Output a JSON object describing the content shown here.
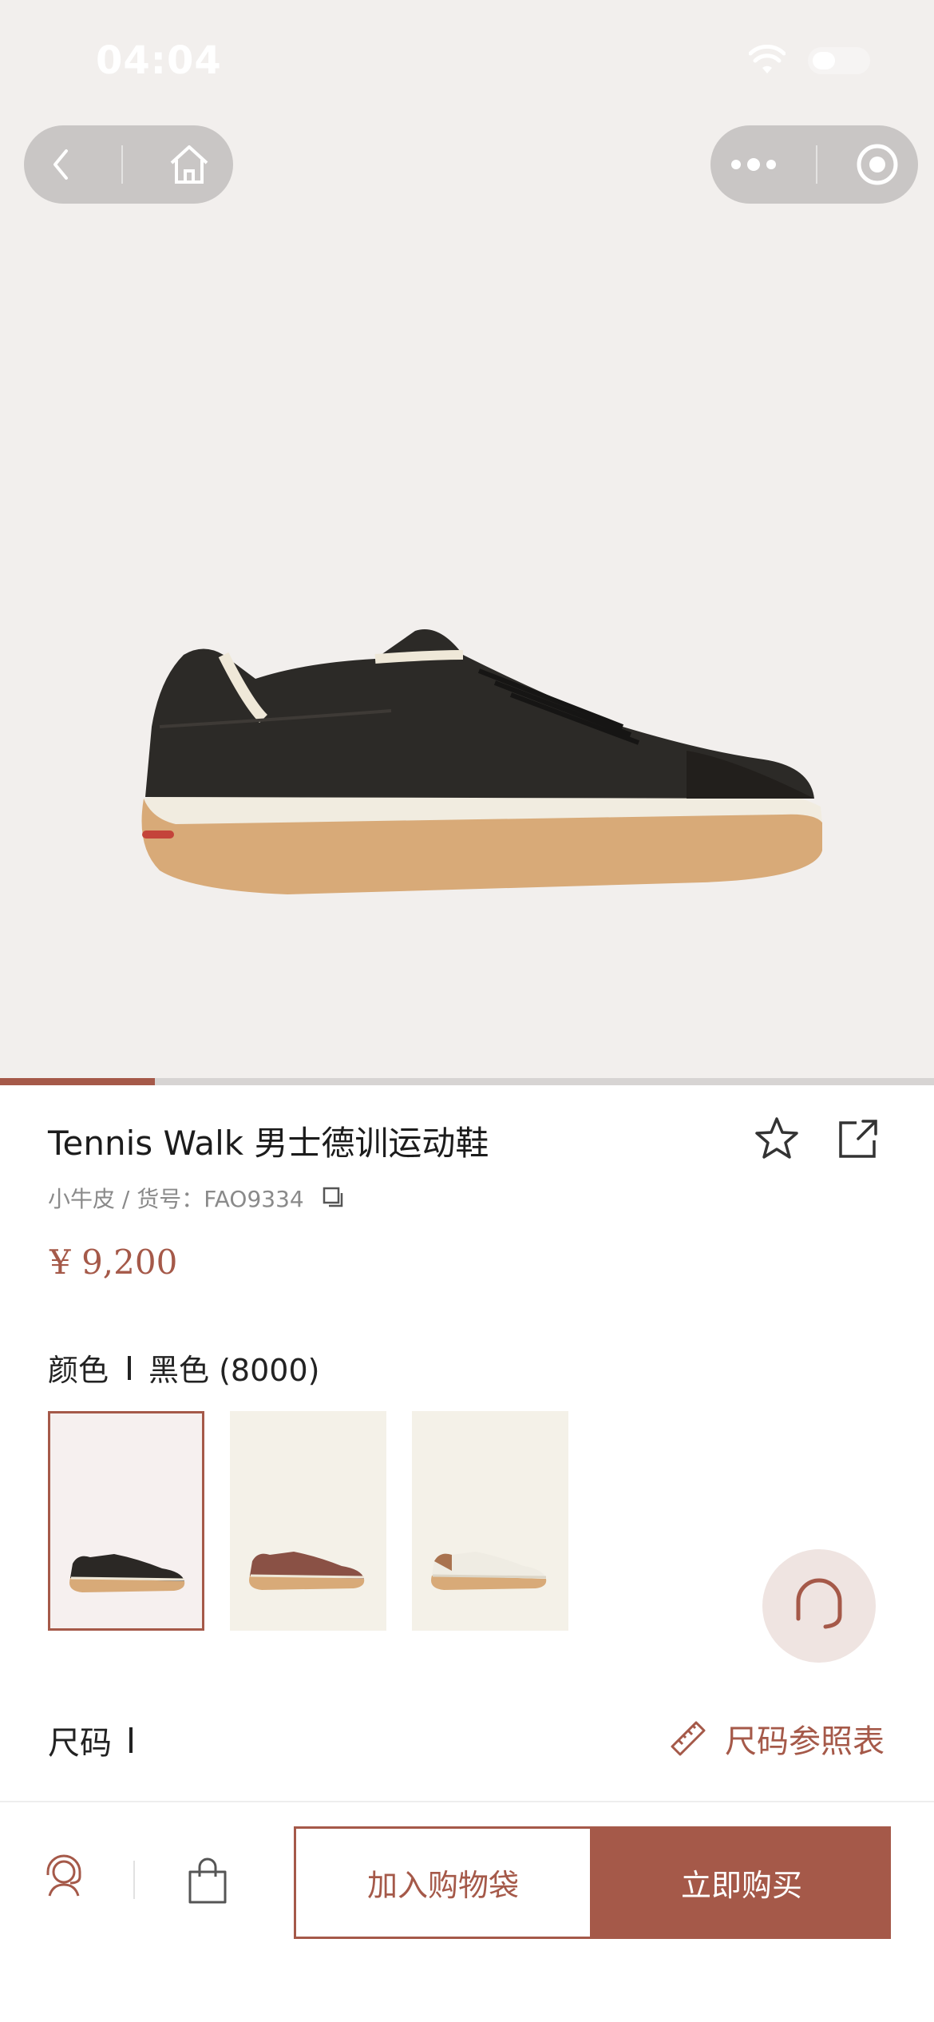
{
  "status_bar": {
    "time": "04:04"
  },
  "nav_capsule": {
    "back_icon": "back-icon",
    "home_icon": "home-icon",
    "more_icon": "more-icon",
    "close_icon": "record-icon"
  },
  "gallery": {
    "progress": 0.166
  },
  "product": {
    "title": "Tennis Walk 男士德训运动鞋",
    "subtitle": "小牛皮 / 货号：FAO9334",
    "price": "¥ 9,200"
  },
  "color": {
    "label": "颜色",
    "selected": "黑色 (8000)",
    "options": [
      {
        "name": "black",
        "hex": "#2b2825"
      },
      {
        "name": "brown",
        "hex": "#8a5145"
      },
      {
        "name": "white",
        "hex": "#efece3"
      }
    ]
  },
  "size": {
    "label": "尺码",
    "guide": "尺码参照表"
  },
  "actions": {
    "add_to_bag": "加入购物袋",
    "buy_now": "立即购买"
  },
  "colors": {
    "accent": "#a55949"
  }
}
